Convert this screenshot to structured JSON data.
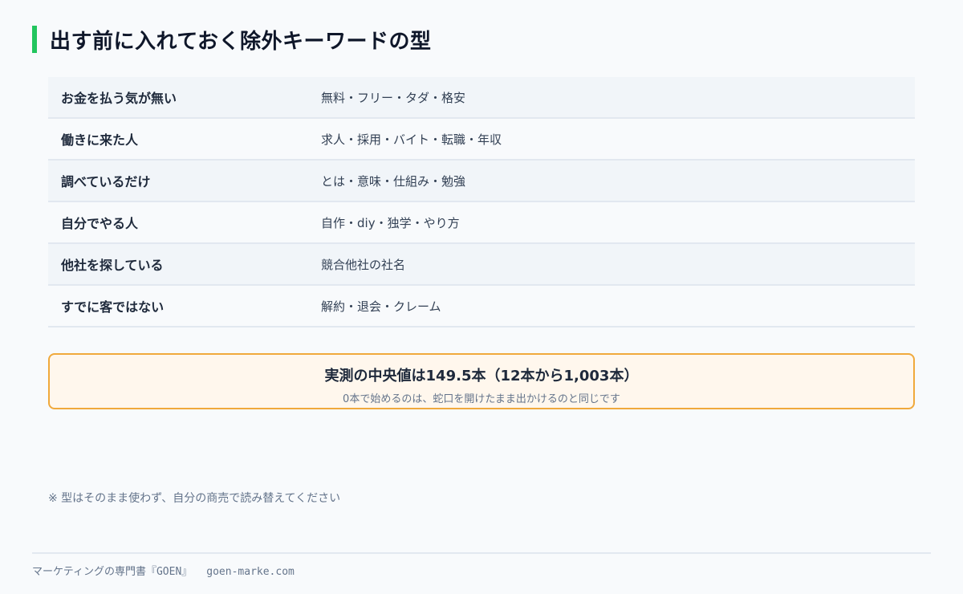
{
  "title": "出す前に入れておく除外キーワードの型",
  "rows": [
    {
      "label": "お金を払う気が無い",
      "words": "無料・フリー・タダ・格安"
    },
    {
      "label": "働きに来た人",
      "words": "求人・採用・バイト・転職・年収"
    },
    {
      "label": "調べているだけ",
      "words": "とは・意味・仕組み・勉強"
    },
    {
      "label": "自分でやる人",
      "words": "自作・diy・独学・やり方"
    },
    {
      "label": "他社を探している",
      "words": "競合他社の社名"
    },
    {
      "label": "すでに客ではない",
      "words": "解約・退会・クレーム"
    }
  ],
  "callout": {
    "main": "実測の中央値は149.5本（12本から1,003本）",
    "sub": "0本で始めるのは、蛇口を開けたまま出かけるのと同じです"
  },
  "note": "※ 型はそのまま使わず、自分の商売で読み替えてください",
  "footer": {
    "brand": "マーケティングの専門書『GOEN』",
    "url": "goen-marke.com"
  },
  "colors": {
    "accent": "#22c55e",
    "callout_border": "#f0a93c",
    "callout_bg": "#fff7ed"
  }
}
